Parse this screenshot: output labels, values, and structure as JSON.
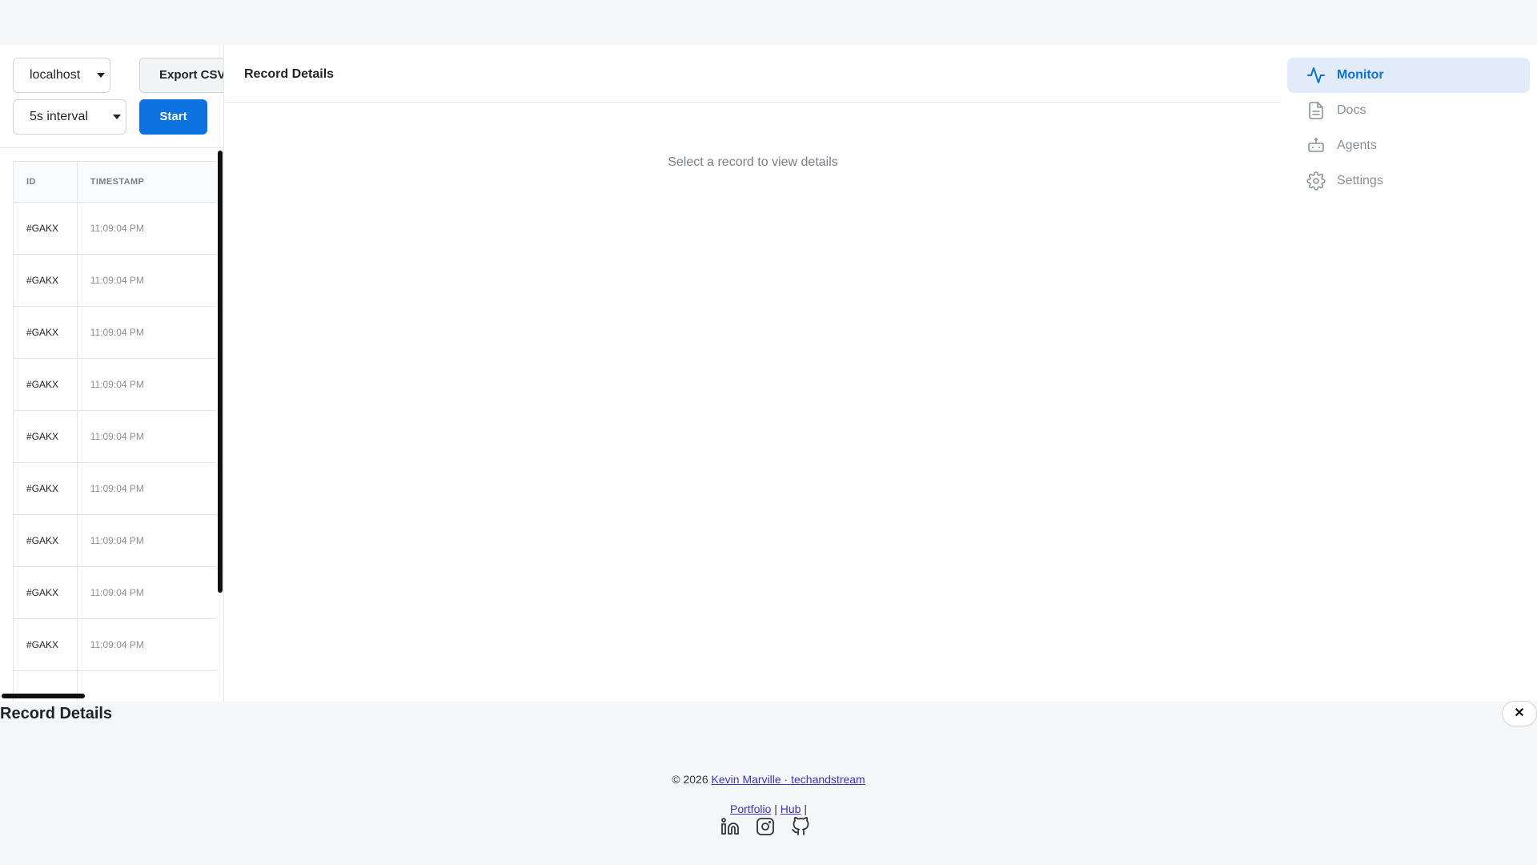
{
  "toolbar": {
    "host_select": "localhost",
    "interval_select": "5s interval",
    "export_label": "Export CSV",
    "start_label": "Start"
  },
  "table": {
    "headers": {
      "id": "ID",
      "timestamp": "TIMESTAMP"
    },
    "rows": [
      {
        "id": "#GAKX",
        "timestamp": "11:09:04 PM"
      },
      {
        "id": "#GAKX",
        "timestamp": "11:09:04 PM"
      },
      {
        "id": "#GAKX",
        "timestamp": "11:09:04 PM"
      },
      {
        "id": "#GAKX",
        "timestamp": "11:09:04 PM"
      },
      {
        "id": "#GAKX",
        "timestamp": "11:09:04 PM"
      },
      {
        "id": "#GAKX",
        "timestamp": "11:09:04 PM"
      },
      {
        "id": "#GAKX",
        "timestamp": "11:09:04 PM"
      },
      {
        "id": "#GAKX",
        "timestamp": "11:09:04 PM"
      },
      {
        "id": "#GAKX",
        "timestamp": "11:09:04 PM"
      }
    ]
  },
  "detail": {
    "title": "Record Details",
    "placeholder": "Select a record to view details"
  },
  "nav": {
    "items": [
      {
        "label": "Monitor",
        "icon": "activity-icon",
        "active": true
      },
      {
        "label": "Docs",
        "icon": "document-icon",
        "active": false
      },
      {
        "label": "Agents",
        "icon": "robot-icon",
        "active": false
      },
      {
        "label": "Settings",
        "icon": "gear-icon",
        "active": false
      }
    ]
  },
  "drawer": {
    "title": "Record Details",
    "close_label": "✕"
  },
  "footer": {
    "copyright": "© 2026",
    "author_link": "Kevin Marville · techandstream",
    "links": [
      "Portfolio",
      "Hub"
    ],
    "separator": "|",
    "socials": [
      "linkedin-icon",
      "instagram-icon",
      "github-icon"
    ]
  },
  "colors": {
    "accent": "#0b72e0",
    "nav_active_bg": "#e1ebf9",
    "link": "#3b34c6"
  }
}
